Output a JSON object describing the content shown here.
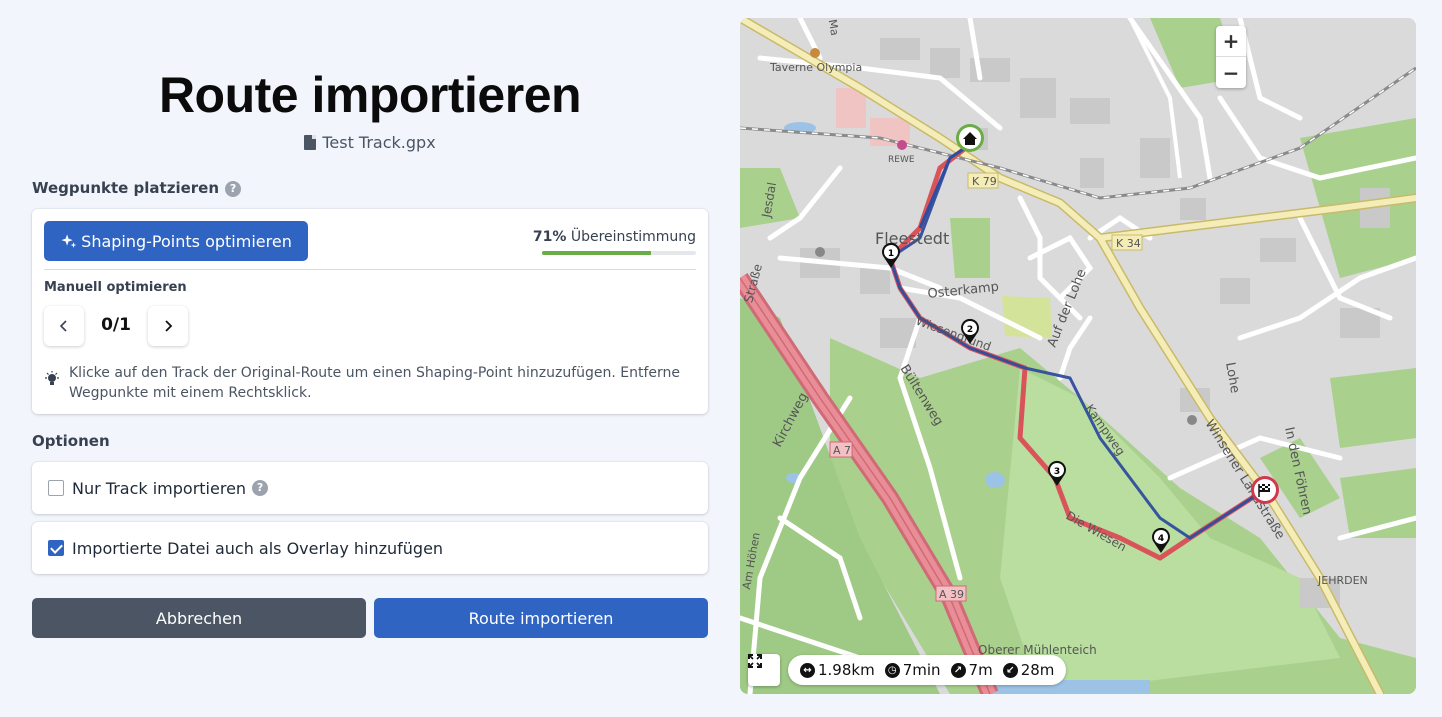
{
  "page": {
    "title": "Route importieren",
    "filename": "Test Track.gpx"
  },
  "waypoints": {
    "section_title": "Wegpunkte platzieren",
    "help_icon": "question-circle-icon",
    "optimize_button": "Shaping-Points optimieren",
    "optimize_icon": "sparkles-icon",
    "match_percent_label": "71%",
    "match_label": "Übereinstimmung",
    "match_fraction": 0.71,
    "manual_label": "Manuell optimieren",
    "counter": "0/1",
    "prev_icon": "chevron-left-icon",
    "next_icon": "chevron-right-icon",
    "hint_icon": "lightbulb-icon",
    "hint": "Klicke auf den Track der Original-Route um einen Shaping-Point hinzuzufügen. Entferne Wegpunkte mit einem Rechtsklick."
  },
  "options": {
    "section_title": "Optionen",
    "items": [
      {
        "label": "Nur Track importieren",
        "checked": false,
        "has_help": true
      },
      {
        "label": "Importierte Datei auch als Overlay hinzufügen",
        "checked": true,
        "has_help": false
      }
    ]
  },
  "actions": {
    "cancel": "Abbrechen",
    "submit": "Route importieren"
  },
  "map": {
    "zoom_in": "+",
    "zoom_out": "−",
    "labels": {
      "taverne": "Taverne Olympia",
      "rewe": "REWE",
      "k79": "K 79",
      "k34": "K 34",
      "fleestedt": "Fleestedt",
      "osterkamp": "Osterkamp",
      "jesdal": "Jesdal",
      "strasse": "Straße",
      "aufderlohe": "Auf der Lohe",
      "lohe": "Lohe",
      "bueltenweg": "Bültenweg",
      "kirchweg": "Kirchweg",
      "a7": "A 7",
      "a39": "A 39",
      "diewiesen": "Die Wiesen",
      "kampweg": "Kampweg",
      "winsener": "Winsener Landstraße",
      "indenfoehren": "In den Föhren",
      "jehrden": "JEHRDEN",
      "obererm": "Oberer Mühlenteich",
      "hoehen": "Am Höhen",
      "wiesengrund": "Wiesengrund",
      "m": "Ma"
    },
    "waypoints": [
      "1",
      "2",
      "3",
      "4"
    ],
    "start_icon": "home-icon",
    "finish_icon": "checkered-flag-icon",
    "fullscreen_icon": "fullscreen-icon",
    "stats": {
      "distance": "1.98km",
      "duration": "7min",
      "ascent": "7m",
      "descent": "28m",
      "distance_icon": "distance-icon",
      "duration_icon": "clock-icon",
      "ascent_icon": "arrow-up-right-icon",
      "descent_icon": "arrow-down-left-icon"
    },
    "colors": {
      "original_track": "#d9545a",
      "route": "#2f4d9e",
      "start_marker": "#6aac45",
      "finish_marker": "#d0394a"
    }
  }
}
